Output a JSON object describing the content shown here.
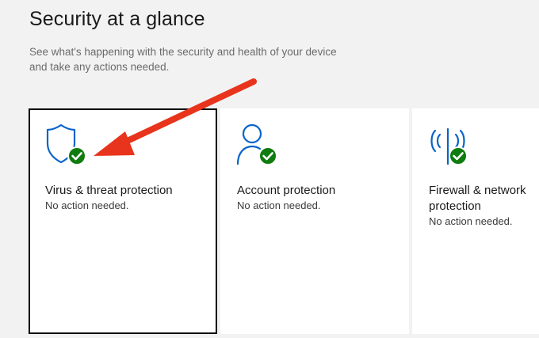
{
  "header": {
    "title": "Security at a glance",
    "subtitle": "See what's happening with the security and health of your device and take any actions needed."
  },
  "cards": [
    {
      "title": "Virus & threat protection",
      "status": "No action needed.",
      "icon": "shield-check-icon"
    },
    {
      "title": "Account protection",
      "status": "No action needed.",
      "icon": "person-check-icon"
    },
    {
      "title": "Firewall & network protection",
      "status": "No action needed.",
      "icon": "antenna-check-icon"
    }
  ],
  "colors": {
    "icon_blue": "#0a63c9",
    "check_green": "#107c10",
    "annotation_arrow": "#e8341c"
  }
}
